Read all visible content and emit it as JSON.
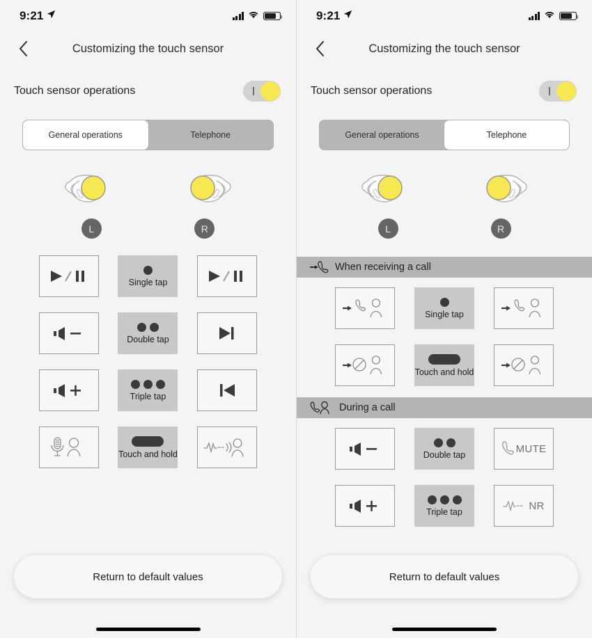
{
  "panels": [
    {
      "id": "general",
      "statusbar": {
        "time": "9:21",
        "location_icon": "location-arrow-icon",
        "signal_icon": "cellular-bars-icon",
        "wifi_icon": "wifi-icon",
        "battery_icon": "battery-icon"
      },
      "nav": {
        "back_icon": "chevron-left-icon",
        "title": "Customizing the touch sensor"
      },
      "toggle": {
        "label": "Touch sensor operations",
        "state": "on",
        "knob_color": "#f7e751",
        "track_color": "#d2d2d2"
      },
      "segmented": {
        "options": [
          "General operations",
          "Telephone"
        ],
        "selected": "General operations"
      },
      "earbuds": [
        {
          "side": "L",
          "badge": "L",
          "highlight_color": "#f7e751",
          "flip": false
        },
        {
          "side": "R",
          "badge": "R",
          "highlight_color": "#f7e751",
          "flip": true
        }
      ],
      "sections": [
        {
          "header": null,
          "rows": [
            {
              "left": {
                "icon": "play-pause-icon",
                "label": ""
              },
              "gesture": {
                "icon": "single-tap-icon",
                "label": "Single tap",
                "dots": 1
              },
              "right": {
                "icon": "play-pause-icon",
                "label": ""
              }
            },
            {
              "left": {
                "icon": "volume-down-icon",
                "label": ""
              },
              "gesture": {
                "icon": "double-tap-icon",
                "label": "Double tap",
                "dots": 2
              },
              "right": {
                "icon": "next-track-icon",
                "label": ""
              }
            },
            {
              "left": {
                "icon": "volume-up-icon",
                "label": ""
              },
              "gesture": {
                "icon": "triple-tap-icon",
                "label": "Triple tap",
                "dots": 3
              },
              "right": {
                "icon": "previous-track-icon",
                "label": ""
              }
            },
            {
              "left": {
                "icon": "voice-assistant-icon",
                "label": ""
              },
              "gesture": {
                "icon": "touch-and-hold-icon",
                "label": "Touch and hold",
                "dots": 0
              },
              "right": {
                "icon": "ambient-sound-icon",
                "label": ""
              }
            }
          ]
        }
      ],
      "reset_button": "Return to default values"
    },
    {
      "id": "telephone",
      "statusbar": {
        "time": "9:21",
        "location_icon": "location-arrow-icon",
        "signal_icon": "cellular-bars-icon",
        "wifi_icon": "wifi-icon",
        "battery_icon": "battery-icon"
      },
      "nav": {
        "back_icon": "chevron-left-icon",
        "title": "Customizing the touch sensor"
      },
      "toggle": {
        "label": "Touch sensor operations",
        "state": "on",
        "knob_color": "#f7e751",
        "track_color": "#d2d2d2"
      },
      "segmented": {
        "options": [
          "General operations",
          "Telephone"
        ],
        "selected": "Telephone"
      },
      "earbuds": [
        {
          "side": "L",
          "badge": "L",
          "highlight_color": "#f7e751",
          "flip": false
        },
        {
          "side": "R",
          "badge": "R",
          "highlight_color": "#f7e751",
          "flip": true
        }
      ],
      "sections": [
        {
          "header": {
            "icon": "incoming-call-icon",
            "label": "When receiving a call"
          },
          "rows": [
            {
              "left": {
                "icon": "answer-call-icon",
                "label": ""
              },
              "gesture": {
                "icon": "single-tap-icon",
                "label": "Single tap",
                "dots": 1
              },
              "right": {
                "icon": "answer-call-icon",
                "label": ""
              }
            },
            {
              "left": {
                "icon": "reject-call-icon",
                "label": ""
              },
              "gesture": {
                "icon": "touch-and-hold-icon",
                "label": "Touch and hold",
                "dots": 0
              },
              "right": {
                "icon": "reject-call-icon",
                "label": ""
              }
            }
          ]
        },
        {
          "header": {
            "icon": "during-call-icon",
            "label": "During a call"
          },
          "rows": [
            {
              "left": {
                "icon": "volume-down-icon",
                "label": ""
              },
              "gesture": {
                "icon": "double-tap-icon",
                "label": "Double tap",
                "dots": 2
              },
              "right": {
                "icon": "mute-icon",
                "label": "MUTE"
              }
            },
            {
              "left": {
                "icon": "volume-up-icon",
                "label": ""
              },
              "gesture": {
                "icon": "triple-tap-icon",
                "label": "Triple tap",
                "dots": 3
              },
              "right": {
                "icon": "noise-reduction-icon",
                "label": "NR"
              }
            }
          ]
        }
      ],
      "reset_button": "Return to default values"
    }
  ]
}
